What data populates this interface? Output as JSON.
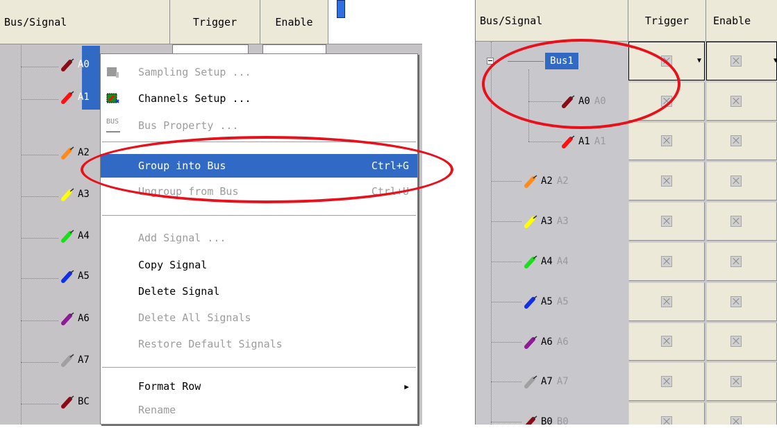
{
  "left": {
    "headers": {
      "signal": "Bus/Signal",
      "trigger": "Trigger",
      "enable": "Enable"
    },
    "signals": [
      {
        "name": "A0",
        "color": "#8b0a14"
      },
      {
        "name": "A1",
        "color": "#ff1010"
      },
      {
        "name": "A2",
        "color": "#ff8c1a"
      },
      {
        "name": "A3",
        "color": "#ffff00"
      },
      {
        "name": "A4",
        "color": "#1adf1a"
      },
      {
        "name": "A5",
        "color": "#1030e8"
      },
      {
        "name": "A6",
        "color": "#8e1a9a"
      },
      {
        "name": "A7",
        "color": "#a0a0a0"
      },
      {
        "name": "BC",
        "color": "#8b0a14"
      }
    ]
  },
  "menu": {
    "items": [
      {
        "label": "Sampling Setup ...",
        "disabled": true,
        "icon": "sampling-setup-icon"
      },
      {
        "label": "Channels Setup ...",
        "disabled": false,
        "icon": "channels-setup-icon"
      },
      {
        "label": "Bus Property ...",
        "disabled": true,
        "icon": "bus-icon"
      },
      {
        "label": "Group into Bus",
        "shortcut": "Ctrl+G",
        "highlighted": true
      },
      {
        "label": "Ungroup from Bus",
        "shortcut": "Ctrl+U",
        "disabled": true
      },
      {
        "label": "Add Signal ...",
        "disabled": true
      },
      {
        "label": "Copy Signal"
      },
      {
        "label": "Delete Signal"
      },
      {
        "label": "Delete All Signals",
        "disabled": true
      },
      {
        "label": "Restore Default Signals",
        "disabled": true
      },
      {
        "label": "Format Row",
        "submenu": true
      },
      {
        "label": "Rename",
        "disabled": true
      }
    ],
    "bus_icon_text": "BUS"
  },
  "right": {
    "headers": {
      "signal": "Bus/Signal",
      "trigger": "Trigger",
      "enable": "Enable"
    },
    "bus": {
      "name": "Bus1"
    },
    "signals": [
      {
        "name": "A0",
        "ghost": "A0",
        "color": "#8b0a14"
      },
      {
        "name": "A1",
        "ghost": "A1",
        "color": "#ff1010"
      },
      {
        "name": "A2",
        "ghost": "A2",
        "color": "#ff8c1a"
      },
      {
        "name": "A3",
        "ghost": "A3",
        "color": "#ffff00"
      },
      {
        "name": "A4",
        "ghost": "A4",
        "color": "#1adf1a"
      },
      {
        "name": "A5",
        "ghost": "A5",
        "color": "#1030e8"
      },
      {
        "name": "A6",
        "ghost": "A6",
        "color": "#8e1a9a"
      },
      {
        "name": "A7",
        "ghost": "A7",
        "color": "#a0a0a0"
      },
      {
        "name": "B0",
        "ghost": "B0",
        "color": "#8b0a14"
      }
    ]
  },
  "colors": {
    "highlight": "#316ac5",
    "annotation": "#e8101a"
  }
}
